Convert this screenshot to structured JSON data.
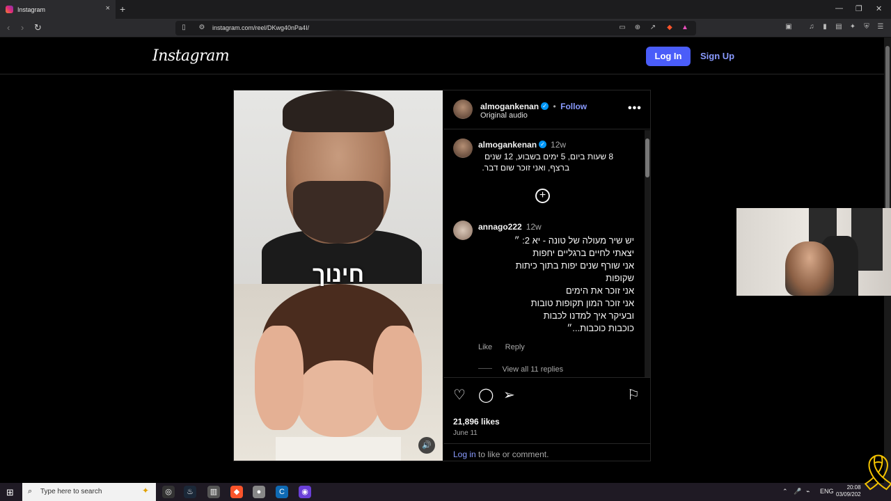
{
  "browser": {
    "tab_title": "Instagram",
    "tab_close": "×",
    "new_tab": "+",
    "url": "instagram.com/reel/DKwg40nPa4I/",
    "window_controls": [
      "—",
      "❐",
      "✕"
    ]
  },
  "header": {
    "logo": "Instagram",
    "login_label": "Log In",
    "signup_label": "Sign Up"
  },
  "post": {
    "video_overlay_text": "חינוך",
    "author": "almogankenan",
    "follow_label": "Follow",
    "dot": "•",
    "audio_label": "Original audio",
    "more_label": "•••",
    "caption": {
      "username": "almogankenan",
      "time": "12w",
      "lines": [
        "8 שעות ביום, 5 ימים בשבוע, 12 שנים",
        "ברצף, ואני זוכר שום דבר."
      ]
    },
    "load_more": "+",
    "comment": {
      "username": "annago222",
      "time": "12w",
      "lines": [
        "יש שיר מעולה של טונה - יא 2: ״",
        "יצאתי לחיים ברגליים יחפות",
        "אני שורף שנים יפות בתוך כיתות",
        "שקופות",
        "אני זוכר את הימים",
        "אני זוכר המון תקופות טובות",
        "ובעיקר איך למדנו לכבות",
        "כוכבות כוכבות...״"
      ],
      "like_label": "Like",
      "reply_label": "Reply",
      "view_replies_label": "View all 11 replies"
    },
    "likes": "21,896 likes",
    "date": "June 11",
    "login_link": "Log in",
    "login_suffix": " to like or comment."
  },
  "taskbar": {
    "search_placeholder": "Type here to search",
    "lang": "ENG",
    "time": "20:08",
    "date": "03/09/202"
  }
}
